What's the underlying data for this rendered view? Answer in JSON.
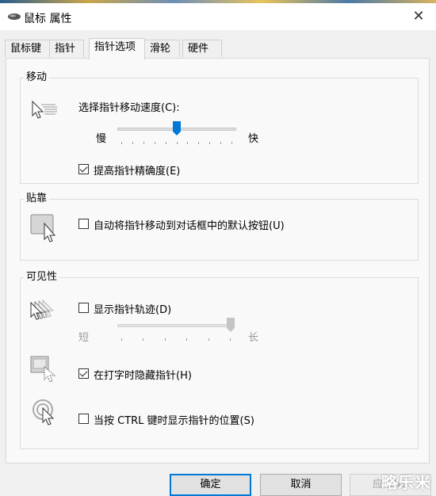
{
  "window": {
    "title": "鼠标 属性",
    "close_glyph": "✕"
  },
  "tabs": [
    {
      "label": "鼠标键",
      "active": false
    },
    {
      "label": "指针",
      "active": false
    },
    {
      "label": "指针选项",
      "active": true
    },
    {
      "label": "滑轮",
      "active": false
    },
    {
      "label": "硬件",
      "active": false
    }
  ],
  "motion": {
    "title": "移动",
    "speed_label": "选择指针移动速度(C):",
    "slow": "慢",
    "fast": "快",
    "speed_level": 0.5,
    "precision_label": "提高指针精确度(E)",
    "precision_checked": true
  },
  "snap": {
    "title": "贴靠",
    "snap_label": "自动将指针移动到对话框中的默认按钮(U)",
    "snap_checked": false
  },
  "visibility": {
    "title": "可见性",
    "trails_label": "显示指针轨迹(D)",
    "trails_checked": false,
    "short": "短",
    "long": "长",
    "trail_level": 1.0,
    "hide_label": "在打字时隐藏指针(H)",
    "hide_checked": true,
    "show_ctrl_label": "当按 CTRL 键时显示指针的位置(S)",
    "show_ctrl_checked": false
  },
  "buttons": {
    "ok": "确定",
    "cancel": "取消",
    "apply": "应用(A)"
  },
  "watermark": "略乐米",
  "colors": {
    "accent": "#0078d7",
    "disabled": "#a0a0a0"
  }
}
